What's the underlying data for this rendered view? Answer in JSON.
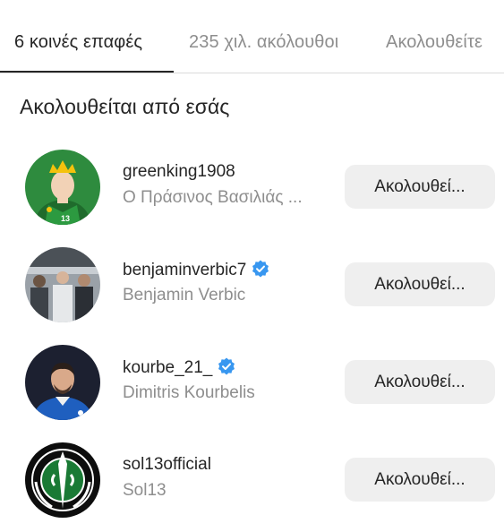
{
  "tabs": [
    {
      "label": "6 κοινές επαφές",
      "active": true
    },
    {
      "label": "235 χιλ. ακόλουθοι",
      "active": false
    },
    {
      "label": "Ακολουθείτε",
      "active": false
    }
  ],
  "section_title": "Ακολουθείται από εσάς",
  "accounts": [
    {
      "username": "greenking1908",
      "full_name": "Ο Πράσινος Βασιλιάς ...",
      "verified": false,
      "button": "Ακολουθεί...",
      "avatar_icon": "crowned-player-avatar"
    },
    {
      "username": "benjaminverbic7",
      "full_name": "Benjamin Verbic",
      "verified": true,
      "button": "Ακολουθεί...",
      "avatar_icon": "airport-group-photo-avatar"
    },
    {
      "username": "kourbe_21_",
      "full_name": "Dimitris Kourbelis",
      "verified": true,
      "button": "Ακολουθεί...",
      "avatar_icon": "player-in-blue-kit-avatar"
    },
    {
      "username": "sol13official",
      "full_name": "Sol13",
      "verified": false,
      "button": "Ακολουθεί...",
      "avatar_icon": "sol13-emblem-avatar"
    }
  ],
  "colors": {
    "verified_badge": "#3897f0",
    "button_bg": "#efefef",
    "secondary_text": "#8e8e8e",
    "primary_text": "#262626"
  }
}
